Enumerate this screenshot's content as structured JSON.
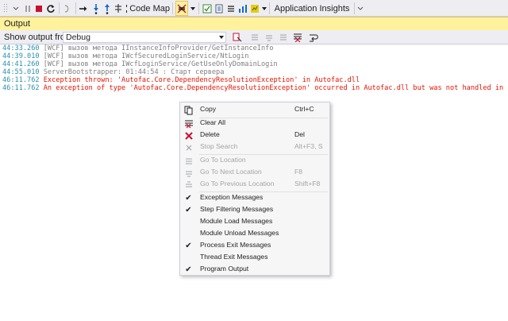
{
  "toolbar": {
    "code_map_label": "Code Map",
    "app_insights_label": "Application Insights",
    "accent": "#68217a"
  },
  "output_window": {
    "title": "Output",
    "show_output_from_label": "Show output from:",
    "source_selected": "Debug"
  },
  "log_lines": [
    {
      "ts": "44:33.260",
      "text": " [WCF] вызов метода IInstanceInfoProvider/GetInstanceInfo"
    },
    {
      "ts": "44:39.010",
      "text": " [WCF] вызов метода IWcfSecuredLoginService/NtLogin"
    },
    {
      "ts": "44:41.260",
      "text": " [WCF] вызов метода IWcfLoginService/GetUseOnlyDomainLogin"
    },
    {
      "ts": "44:55.010",
      "text": " ServerBootstrapper: 01:44:54 : Старт сервера"
    },
    {
      "ts": "46:11.762",
      "text": " Exception thrown: 'Autofac.Core.DependencyResolutionException' in Autofac.dll"
    },
    {
      "ts": "46:11.762",
      "text": " An exception of type 'Autofac.Core.DependencyResolutionException' occurred in Autofac.dll but was not handled in user code"
    }
  ],
  "context_menu": {
    "copy": {
      "label": "Copy",
      "shortcut": "Ctrl+C"
    },
    "clear_all": {
      "label": "Clear All"
    },
    "delete": {
      "label": "Delete",
      "shortcut": "Del"
    },
    "stop_search": {
      "label": "Stop Search",
      "shortcut": "Alt+F3, S"
    },
    "go_to_location": {
      "label": "Go To Location"
    },
    "go_to_next_location": {
      "label": "Go To Next Location",
      "shortcut": "F8"
    },
    "go_to_previous_location": {
      "label": "Go To Previous Location",
      "shortcut": "Shift+F8"
    },
    "exception_messages": {
      "label": "Exception Messages",
      "checked": true
    },
    "step_filtering_messages": {
      "label": "Step Filtering Messages",
      "checked": true
    },
    "module_load_messages": {
      "label": "Module Load Messages",
      "checked": false
    },
    "module_unload_messages": {
      "label": "Module Unload Messages",
      "checked": false
    },
    "process_exit_messages": {
      "label": "Process Exit Messages",
      "checked": true
    },
    "thread_exit_messages": {
      "label": "Thread Exit Messages",
      "checked": false
    },
    "program_output": {
      "label": "Program Output",
      "checked": true
    }
  },
  "colors": {
    "error_text": "#e51400",
    "timestamp_text": "#2b91af",
    "title_bar": "#fff29d"
  }
}
